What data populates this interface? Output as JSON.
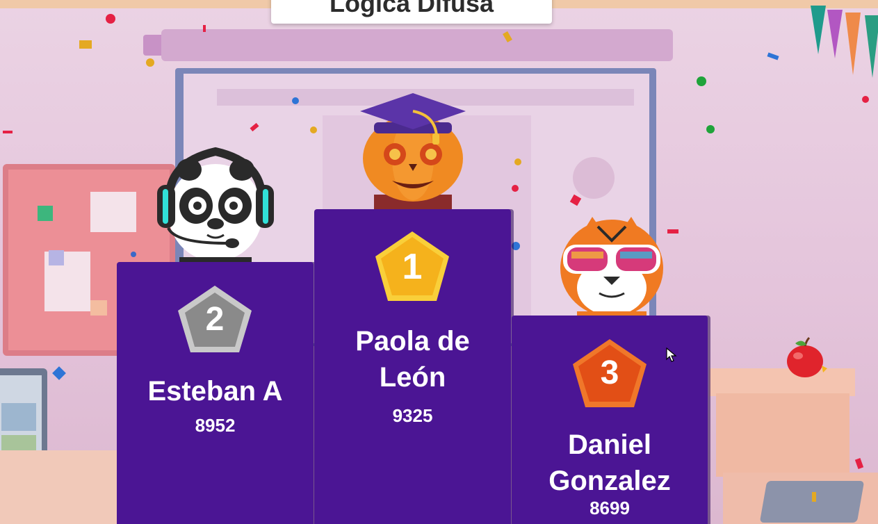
{
  "quiz": {
    "title": "Lógica Difusa"
  },
  "podium": [
    {
      "rank": "1",
      "name": "Paola de León",
      "score": "9325",
      "avatar": "pumpkin-graduate",
      "medal_color": "#f5b21c"
    },
    {
      "rank": "2",
      "name": "Esteban A",
      "score": "8952",
      "avatar": "panda-headset",
      "medal_color": "#8a8a8a"
    },
    {
      "rank": "3",
      "name": "Daniel Gonzalez",
      "score": "8699",
      "avatar": "tiger-sunglasses",
      "medal_color": "#ee5a1c"
    }
  ],
  "colors": {
    "podium": "#4b1594",
    "background": "#e6c7dd"
  }
}
